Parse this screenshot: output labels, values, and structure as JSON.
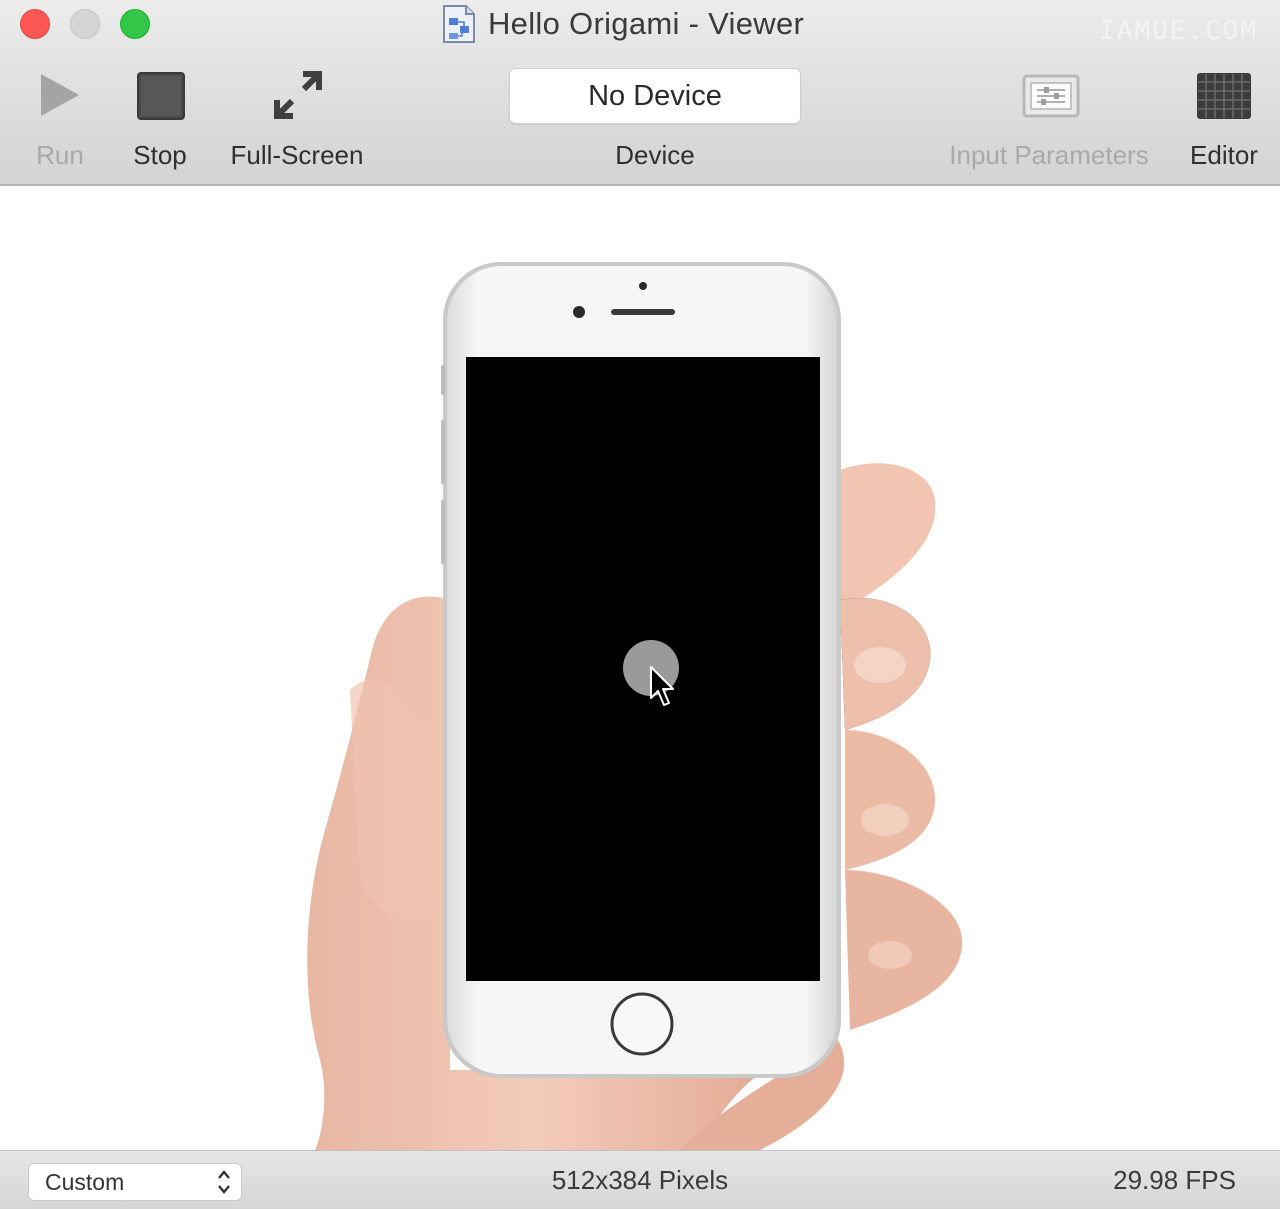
{
  "window": {
    "title": "Hello Origami - Viewer",
    "watermark": "IAMUE.COM",
    "controls": [
      "close-button",
      "minimize-button",
      "zoom-button"
    ]
  },
  "toolbar": {
    "run_label": "Run",
    "stop_label": "Stop",
    "fullscreen_label": "Full-Screen",
    "device_value": "No Device",
    "device_label": "Device",
    "input_parameters_label": "Input Parameters",
    "editor_label": "Editor",
    "icons": {
      "run": "play-icon",
      "stop": "stop-square-icon",
      "fullscreen": "expand-arrows-icon",
      "input_parameters": "sliders-panel-icon",
      "editor": "grid-icon"
    }
  },
  "viewer": {
    "device_preview": "iphone-held-in-hand",
    "screen_color": "#000000",
    "touch_indicator_color": "#9a9a9a"
  },
  "status_bar": {
    "preset_value": "Custom",
    "dimensions": "512x384 Pixels",
    "fps": "29.98 FPS"
  },
  "colors": {
    "close": "#fc5753",
    "minimize": "#d5d5d5",
    "zoom": "#33c748",
    "toolbar_bg": "#dedede"
  }
}
